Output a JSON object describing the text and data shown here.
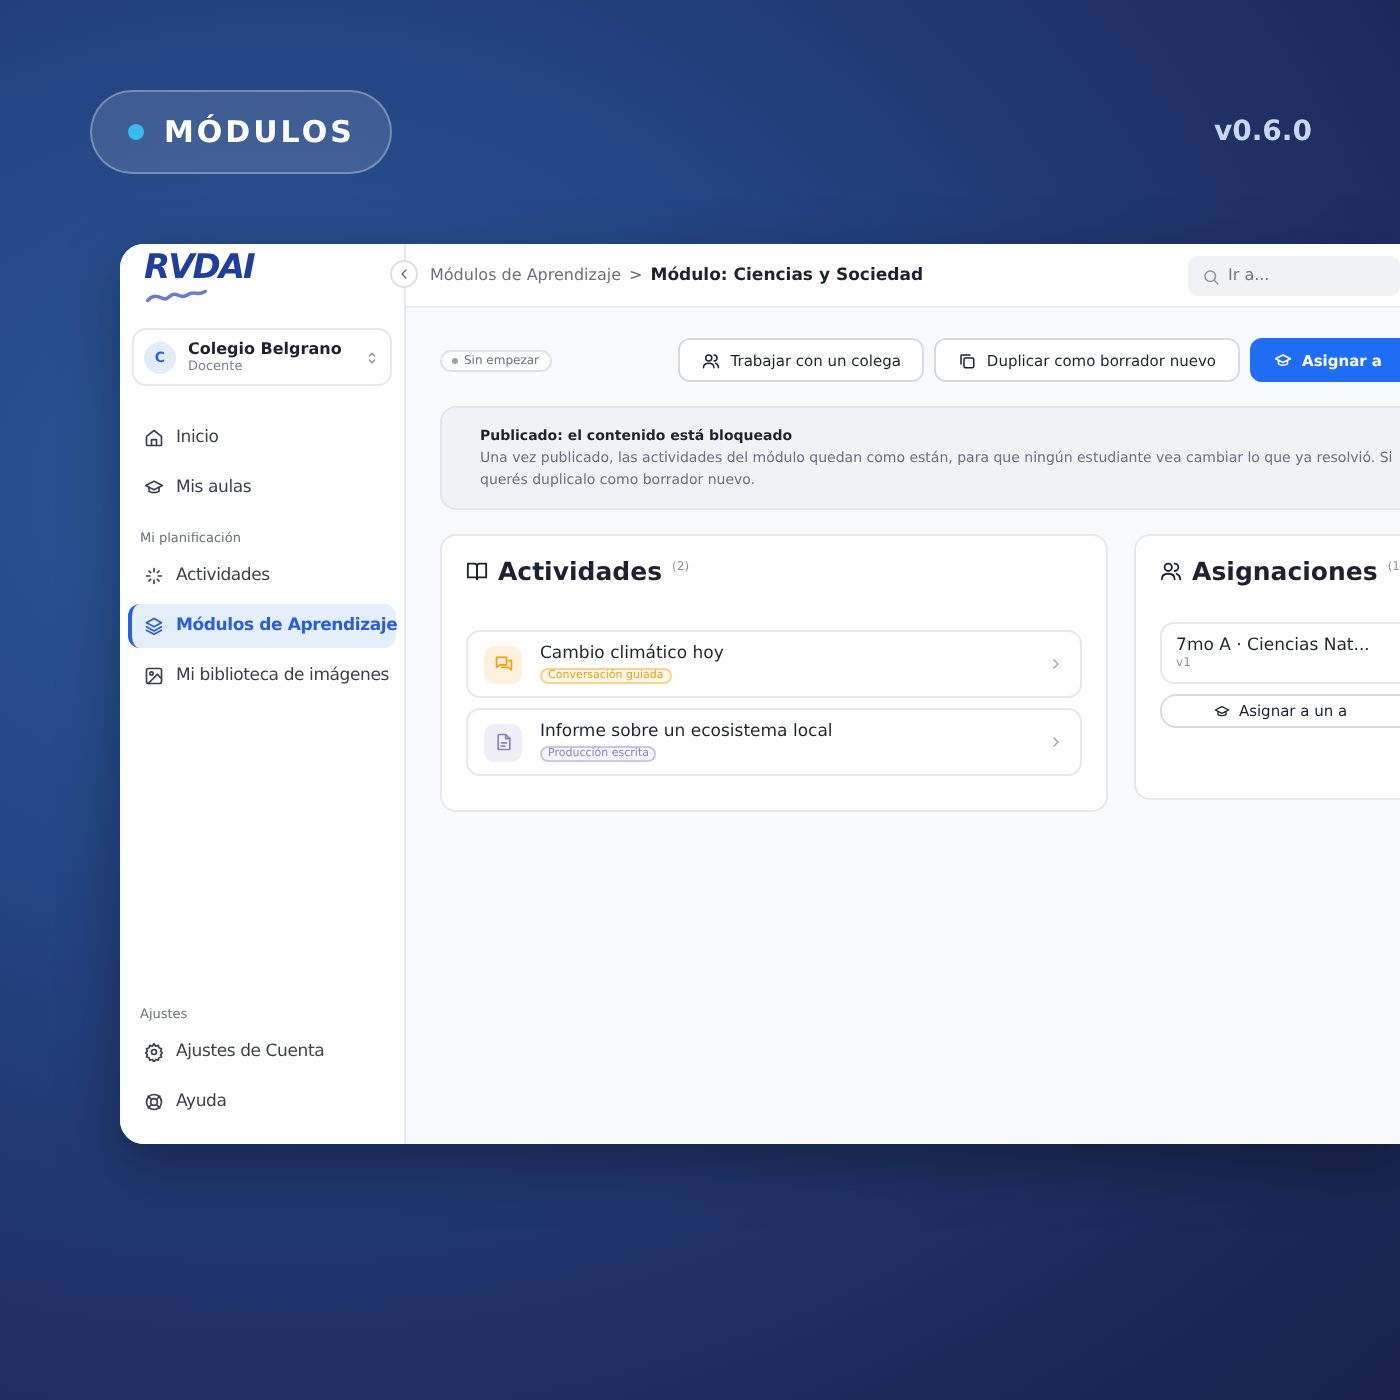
{
  "header": {
    "badge": "MÓDULOS",
    "version": "v0.6.0"
  },
  "sidebar": {
    "logo": "RVDAI",
    "school": {
      "initial": "C",
      "name": "Colegio Belgrano",
      "role": "Docente"
    },
    "nav": [
      {
        "label": "Inicio",
        "selected": false
      },
      {
        "label": "Mis aulas",
        "selected": false
      }
    ],
    "planning": {
      "heading": "Mi planificación",
      "items": [
        {
          "label": "Actividades",
          "selected": false
        },
        {
          "label": "Módulos de Aprendizaje",
          "selected": true
        },
        {
          "label": "Mi biblioteca de imágenes",
          "selected": false
        }
      ]
    },
    "settings": {
      "heading": "Ajustes",
      "items": [
        {
          "label": "Ajustes de Cuenta",
          "selected": false
        },
        {
          "label": "Ayuda",
          "selected": false
        }
      ]
    }
  },
  "topbar": {
    "breadcrumb": {
      "parent": "Módulos de Aprendizaje",
      "separator": ">",
      "current": "Módulo: Ciencias y Sociedad"
    },
    "search": {
      "placeholder": "Ir a..."
    }
  },
  "status_chip": "Sin empezar",
  "actions": [
    {
      "label": "Trabajar con un colega",
      "kind": "outline"
    },
    {
      "label": "Duplicar como borrador nuevo",
      "kind": "outline"
    },
    {
      "label": "Asignar a",
      "kind": "primary"
    }
  ],
  "notice": {
    "title": "Publicado: el contenido está bloqueado",
    "body": "Una vez publicado, las actividades del módulo quedan como están, para que ningún estudiante vea cambiar lo que ya resolvió. Si querés duplicalo como borrador nuevo."
  },
  "activities": {
    "title": "Actividades",
    "count": "(2)",
    "items": [
      {
        "title": "Cambio climático hoy",
        "tag": "Conversación guiada",
        "color": "#f59e0b"
      },
      {
        "title": "Informe sobre un ecosistema local",
        "tag": "Producción escrita",
        "color": "#8b7fc4"
      }
    ]
  },
  "assignments": {
    "title": "Asignaciones",
    "count": "(1",
    "items": [
      {
        "title": "7mo A · Ciencias Nat...",
        "version": "v1"
      }
    ],
    "button": "Asignar a un a"
  }
}
